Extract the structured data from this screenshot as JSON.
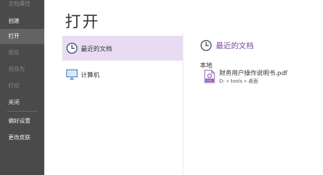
{
  "sidebar": {
    "items": [
      {
        "label": "文档属性"
      },
      {
        "label": "创建"
      },
      {
        "label": "打开"
      },
      {
        "label": "保存"
      },
      {
        "label": "另存为"
      },
      {
        "label": "打印"
      },
      {
        "label": "关闭"
      },
      {
        "label": "偏好设置"
      },
      {
        "label": "更改皮肤"
      }
    ]
  },
  "main": {
    "title": "打开",
    "options": [
      {
        "label": "最近的文档",
        "icon": "clock-icon",
        "selected": true
      },
      {
        "label": "计算机",
        "icon": "computer-icon",
        "selected": false
      }
    ],
    "recent": {
      "heading": "最近的文档",
      "section": "本地",
      "files": [
        {
          "name": "财务用户操作说明书.pdf",
          "path": "D: » tools » 桌面",
          "icon": "pdf-file-icon",
          "badge": "PDF"
        }
      ]
    }
  },
  "colors": {
    "sidebar_bg": "#4a4a4a",
    "sidebar_active": "#636363",
    "selected_option_bg": "#e9dcf2",
    "accent": "#7a4a9e"
  }
}
